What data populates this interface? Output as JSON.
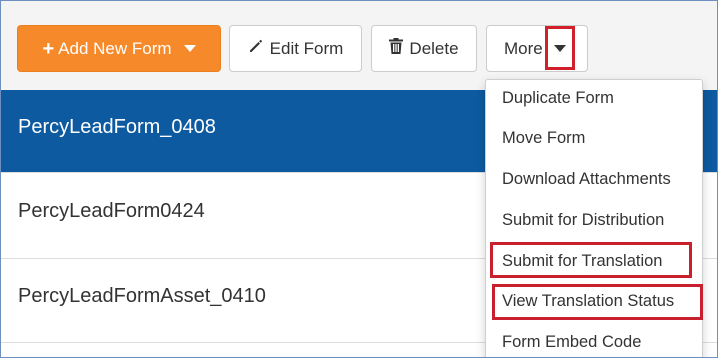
{
  "toolbar": {
    "add_new_form": {
      "plus": "+",
      "label": "Add New Form"
    },
    "edit_form": {
      "label": "Edit Form"
    },
    "delete": {
      "label": "Delete"
    },
    "more": {
      "label": "More"
    }
  },
  "forms": [
    {
      "name": "PercyLeadForm_0408",
      "selected": true
    },
    {
      "name": "PercyLeadForm0424",
      "selected": false
    },
    {
      "name": "PercyLeadFormAsset_0410",
      "selected": false
    }
  ],
  "more_menu": {
    "items": [
      {
        "label": "Duplicate Form"
      },
      {
        "label": "Move Form"
      },
      {
        "label": "Download Attachments"
      },
      {
        "label": "Submit for Distribution"
      },
      {
        "label": "Submit for Translation",
        "highlighted": true
      },
      {
        "label": "View Translation Status",
        "highlighted": true
      },
      {
        "label": "Form Embed Code"
      }
    ]
  },
  "colors": {
    "primary_orange": "#f68a2a",
    "selected_row": "#0d5aa0",
    "highlight_red": "#c8202c",
    "frame_border": "#6d8fbf"
  },
  "icons": {
    "add": "plus-icon",
    "edit": "pencil-icon",
    "delete": "trash-icon",
    "dropdown": "caret-down-icon"
  }
}
